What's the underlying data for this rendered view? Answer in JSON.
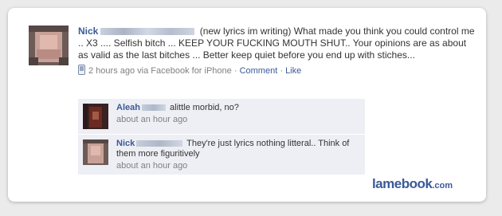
{
  "post": {
    "author": "Nick",
    "text": "(new lyrics im writing) What made you think you could control me .. X3 .... Selfish bitch ... KEEP YOUR FUCKING MOUTH SHUT.. Your opinions are as about as valid as the last bitches ... Better keep quiet before you end up with stiches...",
    "time": "2 hours ago via Facebook for iPhone",
    "comment_link": "Comment",
    "separator": "·",
    "like_link": "Like"
  },
  "comments": [
    {
      "author": "Aleah",
      "text": "alittle morbid, no?",
      "time": "about an hour ago"
    },
    {
      "author": "Nick",
      "text": "They're just lyrics nothing litteral.. Think of them more figuritively",
      "time": "about an hour ago"
    }
  ],
  "brand": {
    "name": "lamebook",
    "suffix": ".com",
    "color": "#3b5998"
  },
  "icons": {
    "phone": "mobile-phone-icon"
  }
}
